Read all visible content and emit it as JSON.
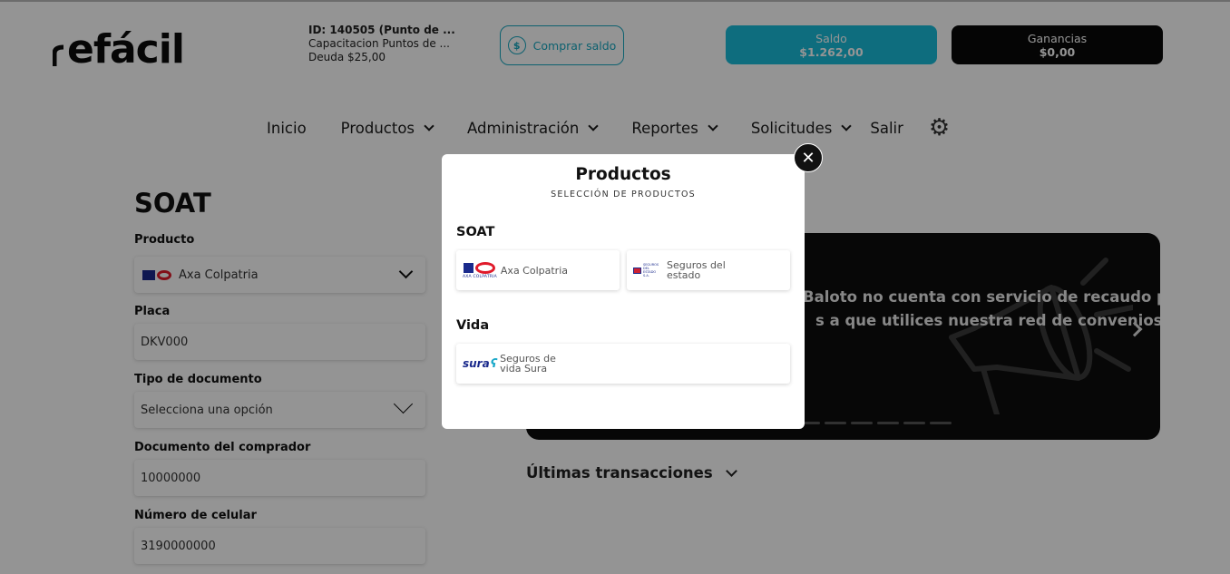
{
  "brand": {
    "logo_text": "efácil"
  },
  "account": {
    "id": "ID: 140505 (Punto de ...",
    "name": "Capacitacion Puntos de ...",
    "debt": "Deuda $25,00"
  },
  "buy_button": {
    "label": "Comprar saldo",
    "icon": "dollar-refresh-icon"
  },
  "balance": {
    "label": "Saldo",
    "value": "$1.262,00",
    "color": "#19bcd9"
  },
  "earnings": {
    "label": "Ganancias",
    "value": "$0,00",
    "color": "#0a0a0a"
  },
  "nav": {
    "items": [
      {
        "label": "Inicio",
        "dropdown": false
      },
      {
        "label": "Productos",
        "dropdown": true
      },
      {
        "label": "Administración",
        "dropdown": true
      },
      {
        "label": "Reportes",
        "dropdown": true
      },
      {
        "label": "Solicitudes",
        "dropdown": true
      },
      {
        "label": "Salir",
        "dropdown": false
      }
    ],
    "settings_icon": "gear-icon"
  },
  "form": {
    "title": "SOAT",
    "product_label": "Producto",
    "product_value": "Axa Colpatria",
    "plate_label": "Placa",
    "plate_placeholder": "DKV000",
    "doc_type_label": "Tipo de documento",
    "doc_type_value": "Selecciona una opción",
    "buyer_doc_label": "Documento del comprador",
    "buyer_doc_placeholder": "10000000",
    "phone_label": "Número de celular",
    "phone_placeholder": "3190000000"
  },
  "banner": {
    "line1": "Baloto no cuenta con servicio de recaudo para",
    "line2": "s a que utilices nuestra red de convenios",
    "slides": 6
  },
  "last_transactions": {
    "label": "Últimas transacciones"
  },
  "modal": {
    "title": "Productos",
    "subtitle": "SELECCIÓN DE PRODUCTOS",
    "sections": [
      {
        "title": "SOAT",
        "items": [
          {
            "name": "Axa Colpatria",
            "logo_caption": "AXA COLPATRIA",
            "icon": "axa-colpatria-logo"
          },
          {
            "name_line1": "Seguros del",
            "name_line2": "estado",
            "logo_caption": "SEGUROS DEL ESTADO S.A.",
            "icon": "seguros-del-estado-logo"
          }
        ]
      },
      {
        "title": "Vida",
        "items": [
          {
            "name_line1": "Seguros de",
            "name_line2": "vida Sura",
            "logo_text": "sura",
            "icon": "sura-logo"
          }
        ]
      }
    ],
    "close_icon": "close-icon"
  }
}
